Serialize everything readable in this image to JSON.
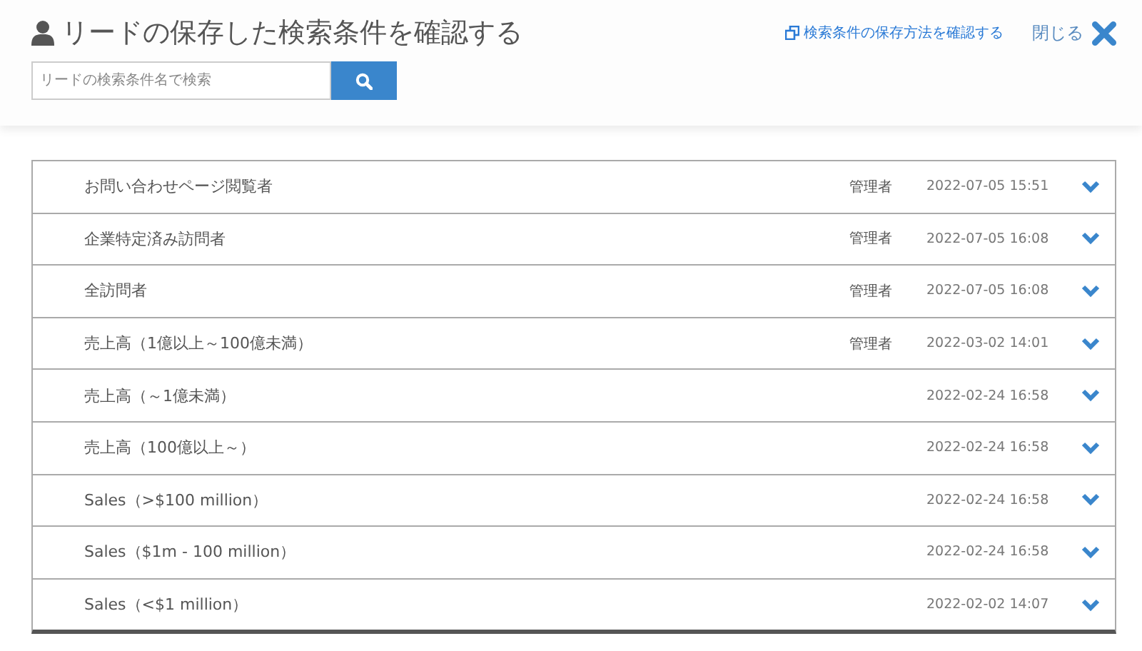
{
  "header": {
    "title": "リードの保存した検索条件を確認する",
    "help_link": "検索条件の保存方法を確認する",
    "close": "閉じる"
  },
  "search": {
    "placeholder": "リードの検索条件名で検索"
  },
  "saved_searches": [
    {
      "name": "お問い合わせページ閲覧者",
      "owner": "管理者",
      "date": "2022-07-05 15:51",
      "expanded": false
    },
    {
      "name": "企業特定済み訪問者",
      "owner": "管理者",
      "date": "2022-07-05 16:08",
      "expanded": false
    },
    {
      "name": "全訪問者",
      "owner": "管理者",
      "date": "2022-07-05 16:08",
      "expanded": false
    },
    {
      "name": "売上高（1億以上～100億未満）",
      "owner": "管理者",
      "date": "2022-03-02 14:01",
      "expanded": false
    },
    {
      "name": "売上高（～1億未満）",
      "date": "2022-02-24 16:58",
      "expanded": false
    },
    {
      "name": "売上高（100億以上～）",
      "date": "2022-02-24 16:58",
      "expanded": false
    },
    {
      "name": "Sales（>$100 million）",
      "date": "2022-02-24 16:58",
      "expanded": false
    },
    {
      "name": "Sales（$1m - 100 million）",
      "date": "2022-02-24 16:58",
      "expanded": false
    },
    {
      "name": "Sales（<$1 million）",
      "date": "2022-02-02 14:07",
      "expanded": false
    }
  ]
}
